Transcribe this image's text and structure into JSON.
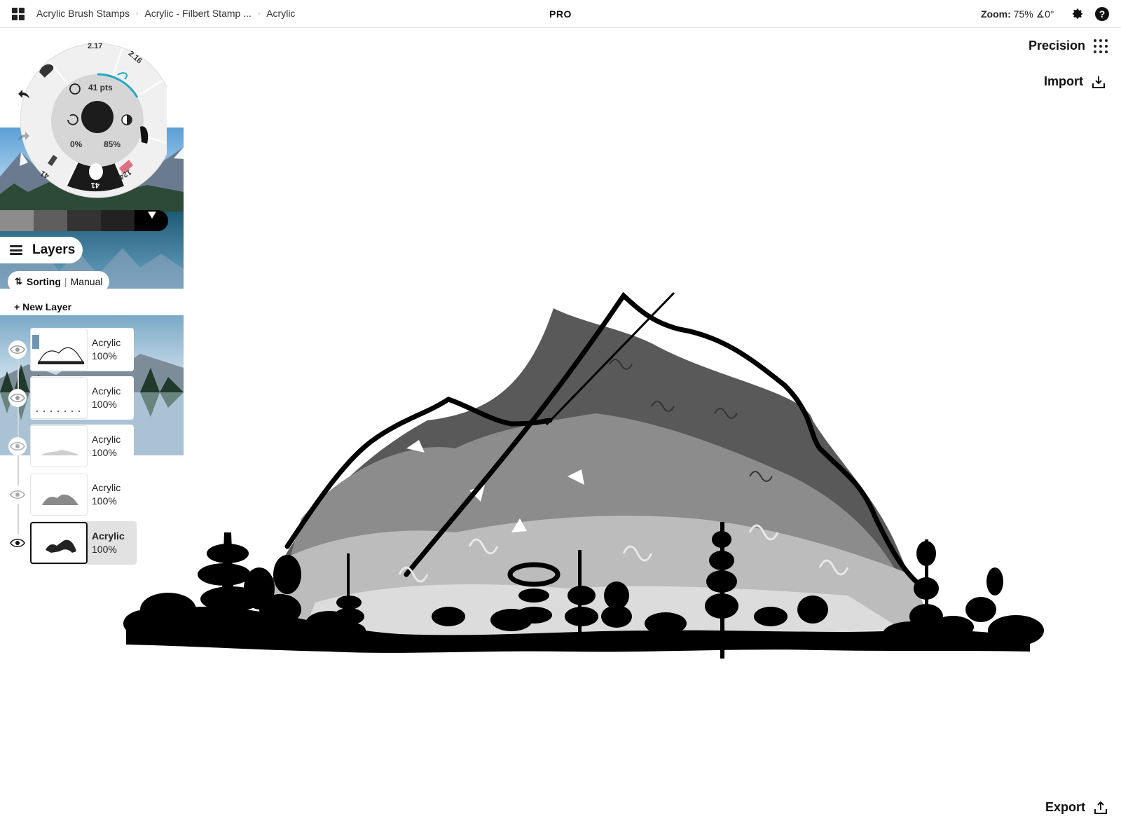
{
  "topbar": {
    "breadcrumbs": [
      "Acrylic Brush Stamps",
      "Acrylic - Filbert Stamp ...",
      "Acrylic"
    ],
    "pro_label": "PRO",
    "zoom_label": "Zoom:",
    "zoom_value": "75%",
    "angle_value": "∡0°",
    "icons": [
      "apps-grid-icon",
      "gear-icon",
      "help-icon"
    ]
  },
  "right_panel": {
    "precision_label": "Precision",
    "import_label": "Import",
    "export_label": "Export"
  },
  "brush_wheel": {
    "size_label": "41 pts",
    "smoothing": "0%",
    "opacity": "85%",
    "preset_top_left": "2.17",
    "preset_top_right": "2.16",
    "preset_bottom_left": "41",
    "preset_bottom": "41",
    "preset_bottom_right": "124",
    "accent_color": "#e07080",
    "highlight_color": "#22a8c8"
  },
  "swatches": [
    "#8c8c8c",
    "#5e5e5e",
    "#333333",
    "#222222",
    "#000000"
  ],
  "layers_panel": {
    "title": "Layers",
    "sorting_label": "Sorting",
    "sorting_value": "Manual",
    "new_layer_label": "New Layer",
    "layers": [
      {
        "name": "Acrylic",
        "opacity": "100%",
        "visible": true,
        "active": false
      },
      {
        "name": "Acrylic",
        "opacity": "100%",
        "visible": true,
        "active": false
      },
      {
        "name": "Acrylic",
        "opacity": "100%",
        "visible": true,
        "active": false
      },
      {
        "name": "Acrylic",
        "opacity": "100%",
        "visible": true,
        "active": false
      },
      {
        "name": "Acrylic",
        "opacity": "100%",
        "visible": true,
        "active": true
      }
    ]
  }
}
